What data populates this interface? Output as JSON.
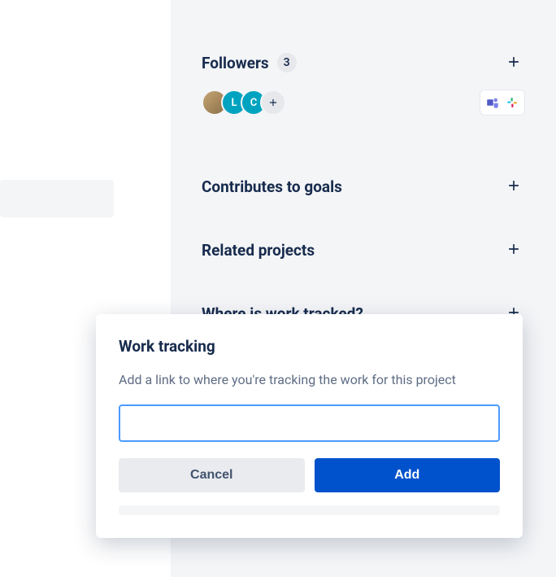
{
  "followers": {
    "title": "Followers",
    "count": "3",
    "avatars": [
      {
        "initial": ""
      },
      {
        "initial": "L"
      },
      {
        "initial": "C"
      }
    ]
  },
  "goals": {
    "title": "Contributes to goals"
  },
  "related": {
    "title": "Related projects"
  },
  "work_tracked": {
    "title": "Where is work tracked?"
  },
  "popup": {
    "title": "Work tracking",
    "description": "Add a link to where you're tracking the work for this project",
    "input_value": "",
    "cancel_label": "Cancel",
    "add_label": "Add"
  }
}
